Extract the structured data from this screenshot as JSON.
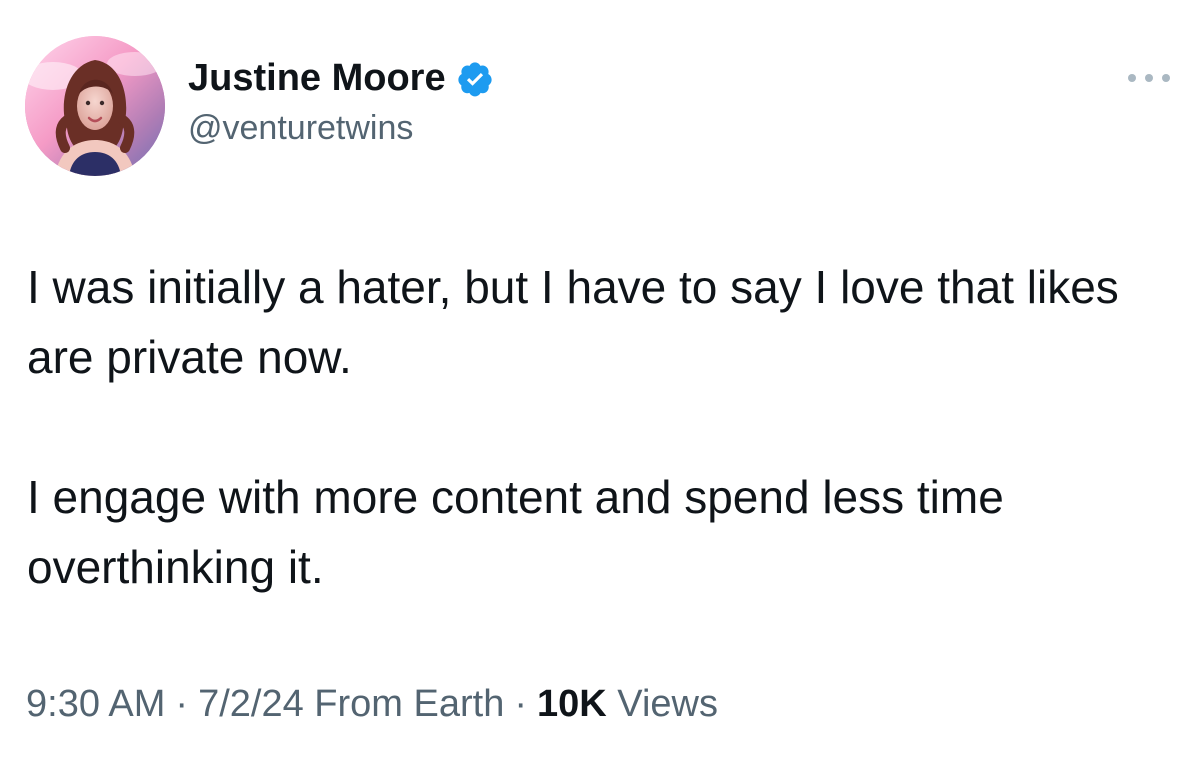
{
  "tweet": {
    "author": {
      "display_name": "Justine Moore",
      "handle": "@venturetwins",
      "verified": true,
      "badge_color": "#1d9bf0"
    },
    "more_icon": "more-horizontal-icon",
    "paragraphs": [
      "I was initially a hater, but I have to say I love that likes are private now.",
      "I engage with more content and spend less time overthinking it."
    ],
    "meta": {
      "time": "9:30 AM",
      "date": "7/2/24",
      "source": "From Earth",
      "separator": "·",
      "views_count": "10K",
      "views_label": "Views"
    }
  },
  "colors": {
    "text_primary": "#0f1419",
    "text_secondary": "#536471",
    "verified": "#1d9bf0"
  }
}
